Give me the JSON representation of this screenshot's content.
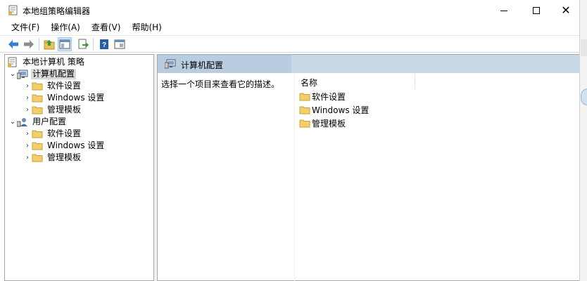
{
  "window": {
    "title": "本地组策略编辑器",
    "controls": {
      "minimize": "minimize",
      "maximize": "maximize",
      "close": "✕"
    }
  },
  "menu": {
    "items": [
      "文件(F)",
      "操作(A)",
      "查看(V)",
      "帮助(H)"
    ]
  },
  "toolbar": {
    "buttons": [
      "back-icon",
      "forward-icon",
      "up-folder-icon",
      "show-hide-tree-icon",
      "export-list-icon",
      "help-icon",
      "properties-icon"
    ]
  },
  "tree": {
    "root": "本地计算机 策略",
    "computer": {
      "label": "计算机配置",
      "children": [
        "软件设置",
        "Windows 设置",
        "管理模板"
      ]
    },
    "user": {
      "label": "用户配置",
      "children": [
        "软件设置",
        "Windows 设置",
        "管理模板"
      ]
    }
  },
  "detail": {
    "header": "计算机配置",
    "description": "选择一个项目来查看它的描述。",
    "column_name": "名称",
    "items": [
      "软件设置",
      "Windows 设置",
      "管理模板"
    ]
  },
  "colors": {
    "header_bg": "#b9cde0",
    "selection": "#d9d9d9",
    "folder": "#f2cf6a"
  }
}
